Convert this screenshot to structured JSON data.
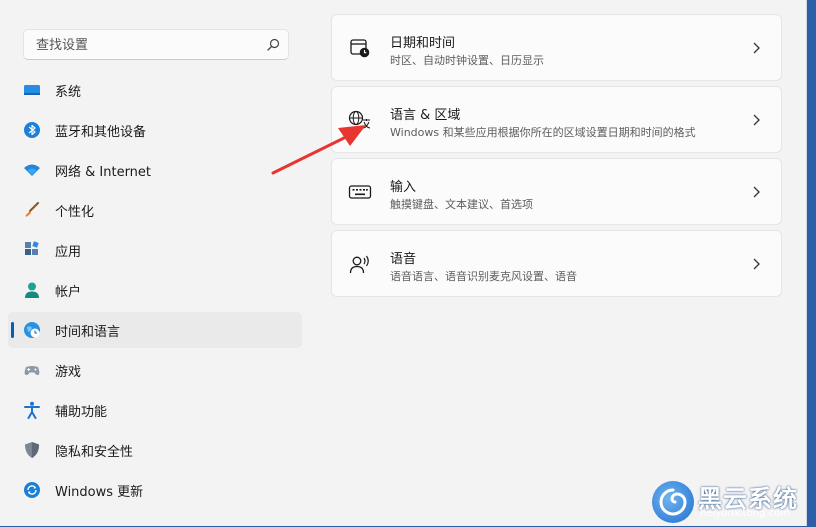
{
  "search": {
    "placeholder": "查找设置"
  },
  "sidebar": {
    "items": [
      {
        "label": "系统"
      },
      {
        "label": "蓝牙和其他设备"
      },
      {
        "label": "网络 & Internet"
      },
      {
        "label": "个性化"
      },
      {
        "label": "应用"
      },
      {
        "label": "帐户"
      },
      {
        "label": "时间和语言",
        "selected": true
      },
      {
        "label": "游戏"
      },
      {
        "label": "辅助功能"
      },
      {
        "label": "隐私和安全性"
      },
      {
        "label": "Windows 更新"
      }
    ]
  },
  "main": {
    "cards": [
      {
        "title": "日期和时间",
        "subtitle": "时区、自动时钟设置、日历显示",
        "icon": "calendar-clock-icon"
      },
      {
        "title": "语言 & 区域",
        "subtitle": "Windows 和某些应用根据你所在的区域设置日期和时间的格式",
        "icon": "language-region-icon"
      },
      {
        "title": "输入",
        "subtitle": "触摸键盘、文本建议、首选项",
        "icon": "keyboard-icon"
      },
      {
        "title": "语音",
        "subtitle": "语音语言、语音识别麦克风设置、语音",
        "icon": "speech-icon"
      }
    ]
  },
  "watermark": {
    "title": "黑云系统",
    "url": "heiyunxitong.com"
  },
  "colors": {
    "accent": "#005fb8",
    "annotation_arrow": "#e8352f"
  }
}
